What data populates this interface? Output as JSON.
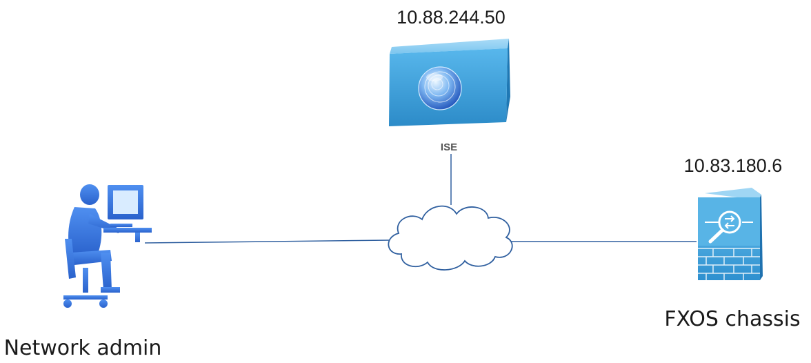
{
  "nodes": {
    "ise": {
      "ip": "10.88.244.50",
      "label": "ISE",
      "icon": "ise-server-icon"
    },
    "fxos": {
      "ip": "10.83.180.6",
      "label": "FXOS chassis",
      "icon": "firewall-appliance-icon"
    },
    "admin": {
      "label": "Network admin",
      "icon": "network-admin-workstation-icon"
    },
    "network": {
      "icon": "network-cloud-icon"
    }
  },
  "colors": {
    "link": "#2f5f9f",
    "device_blue": "#3d9bd6",
    "admin_blue": "#3f7ee0"
  }
}
